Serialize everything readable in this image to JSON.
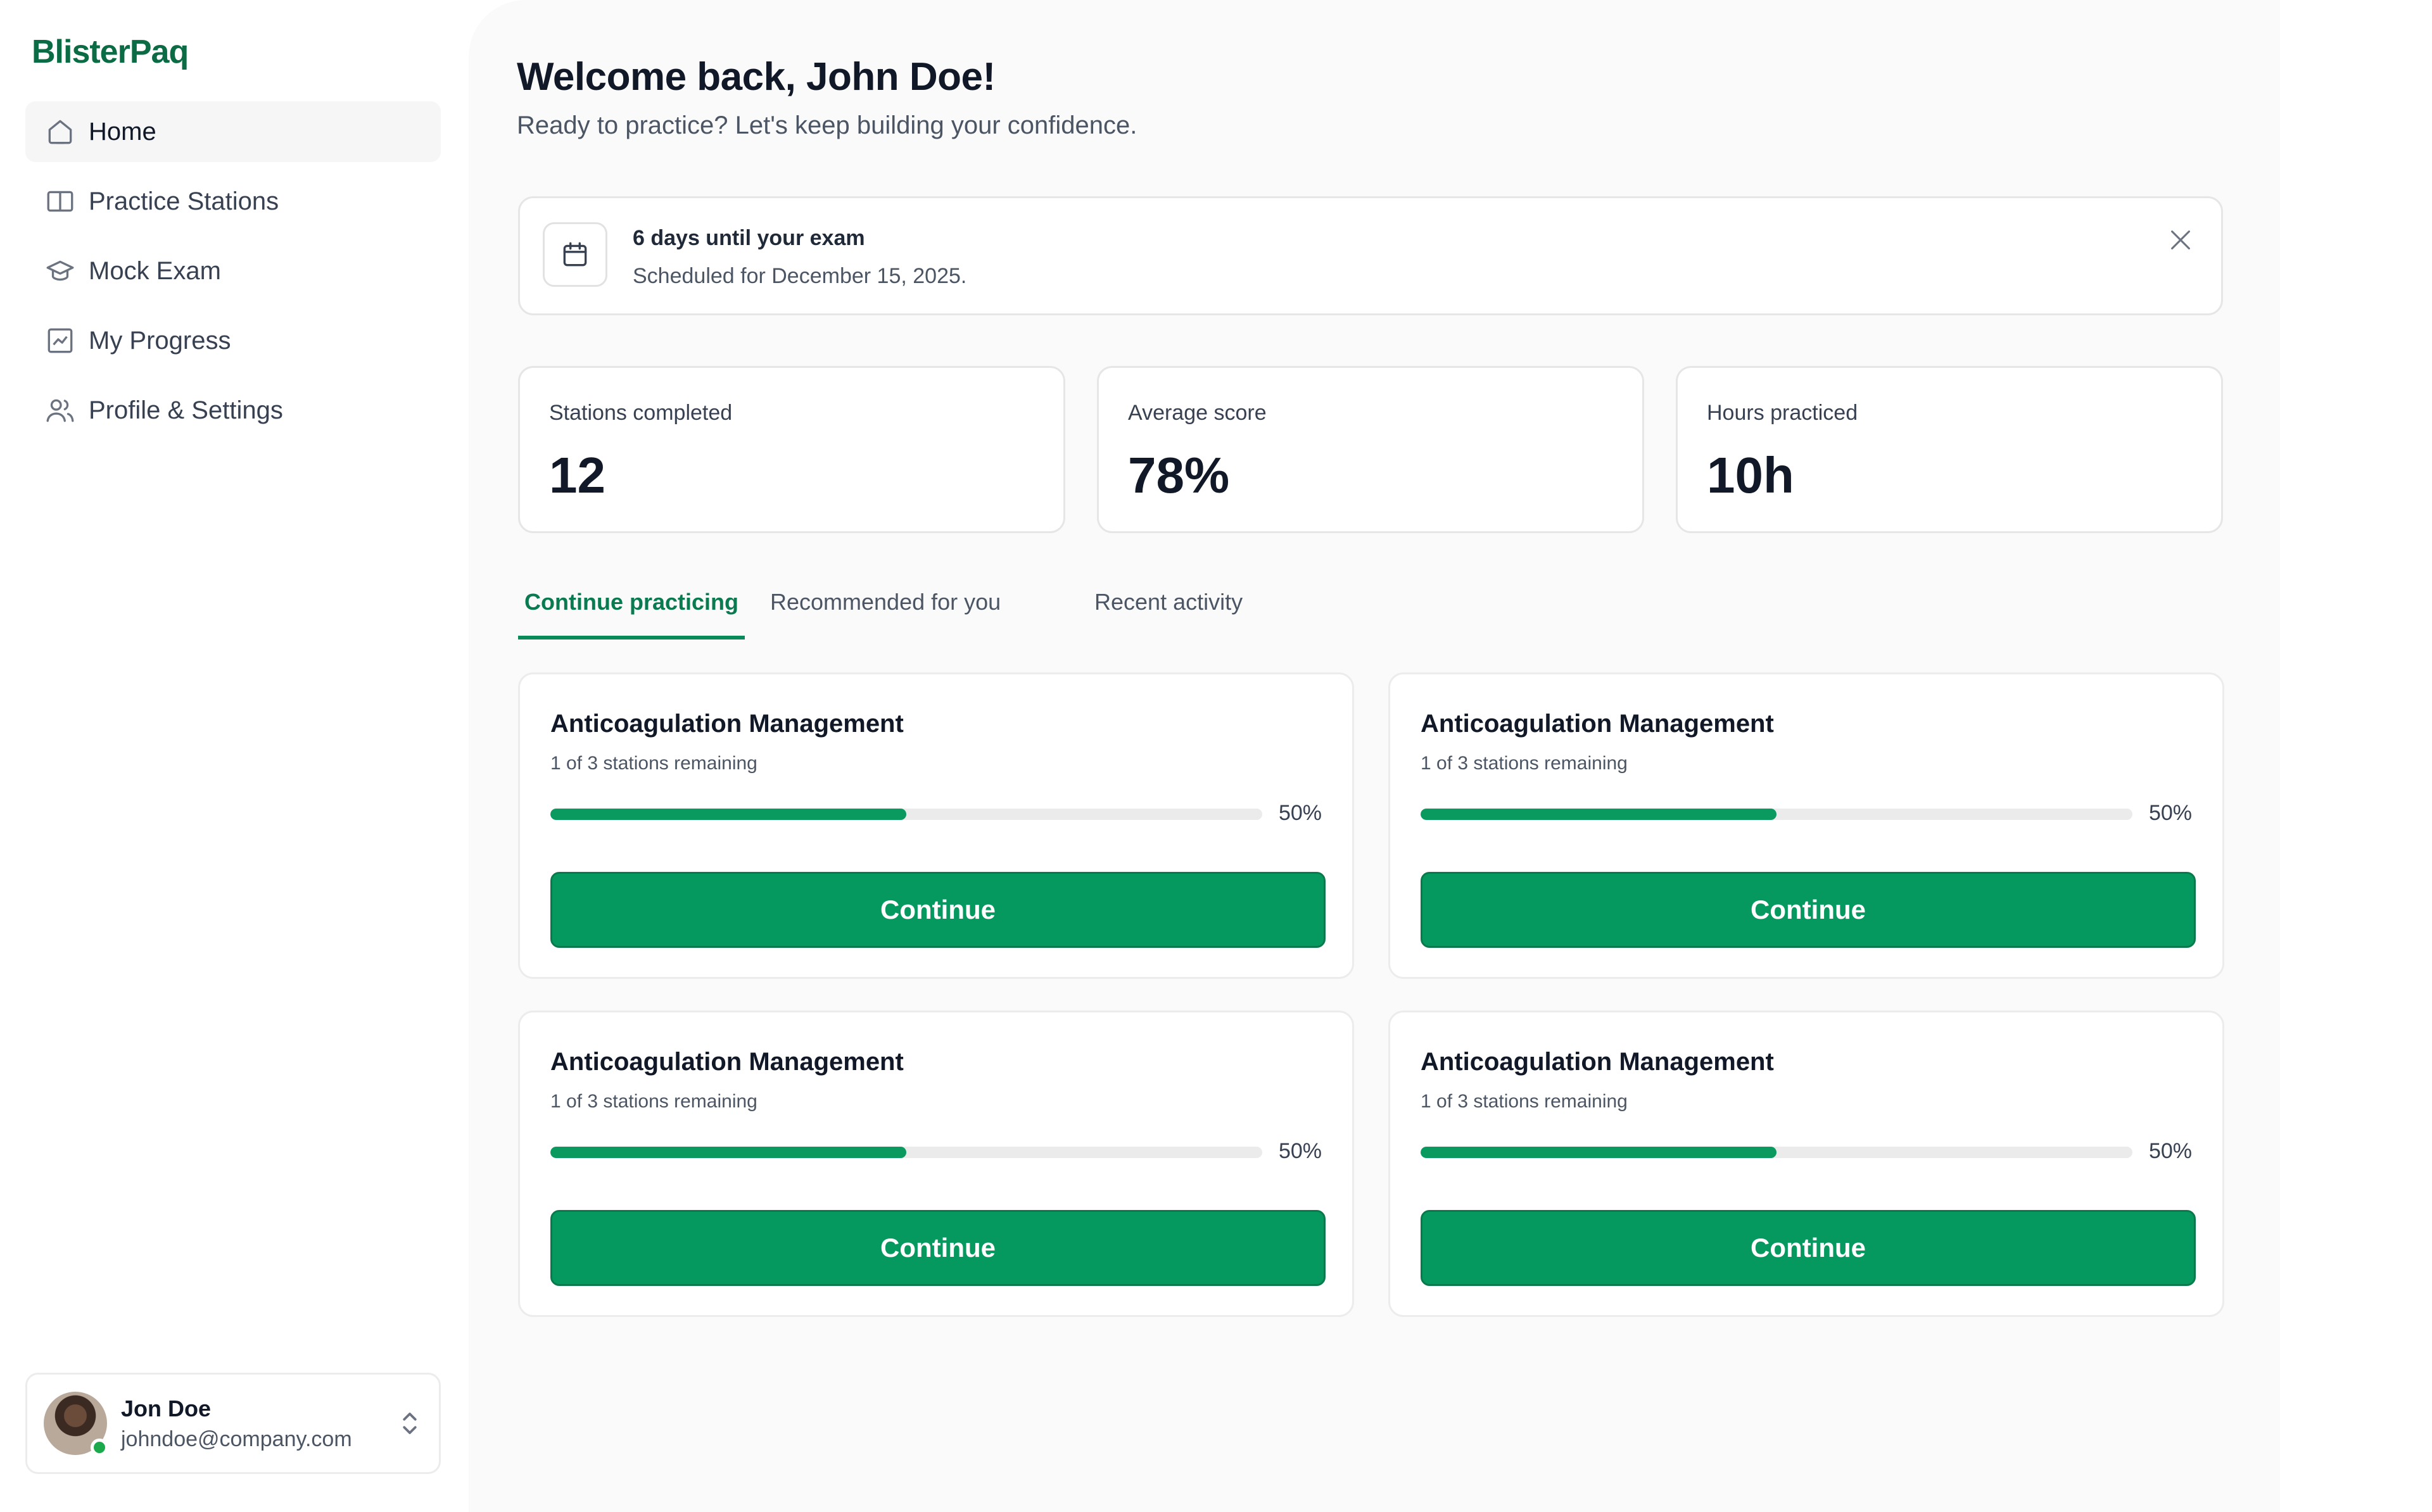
{
  "app": {
    "name": "BlisterPaq"
  },
  "sidebar": {
    "items": [
      {
        "label": "Home",
        "icon": "home-icon",
        "active": true
      },
      {
        "label": "Practice Stations",
        "icon": "book-open-icon",
        "active": false
      },
      {
        "label": "Mock Exam",
        "icon": "graduation-cap-icon",
        "active": false
      },
      {
        "label": "My Progress",
        "icon": "chart-line-icon",
        "active": false
      },
      {
        "label": "Profile & Settings",
        "icon": "users-icon",
        "active": false
      }
    ]
  },
  "user": {
    "name": "Jon Doe",
    "email": "johndoe@company.com",
    "status": "online"
  },
  "header": {
    "title": "Welcome back, John Doe!",
    "subtitle": "Ready to practice? Let's keep building your confidence."
  },
  "exam": {
    "title": "6 days until your exam",
    "subtitle": "Scheduled for December 15, 2025."
  },
  "stats": [
    {
      "label": "Stations completed",
      "value": "12"
    },
    {
      "label": "Average score",
      "value": "78%"
    },
    {
      "label": "Hours practiced",
      "value": "10h"
    }
  ],
  "tabs": [
    {
      "label": "Continue practicing",
      "active": true
    },
    {
      "label": "Recommended for you",
      "active": false
    },
    {
      "label": "Recent activity",
      "active": false
    }
  ],
  "cards": [
    {
      "title": "Anticoagulation Management",
      "subtitle": "1 of 3 stations remaining",
      "progress": 0.5,
      "progress_label": "50%",
      "button": "Continue"
    },
    {
      "title": "Anticoagulation Management",
      "subtitle": "1 of 3 stations remaining",
      "progress": 0.5,
      "progress_label": "50%",
      "button": "Continue"
    },
    {
      "title": "Anticoagulation Management",
      "subtitle": "1 of 3 stations remaining",
      "progress": 0.5,
      "progress_label": "50%",
      "button": "Continue"
    },
    {
      "title": "Anticoagulation Management",
      "subtitle": "1 of 3 stations remaining",
      "progress": 0.5,
      "progress_label": "50%",
      "button": "Continue"
    }
  ],
  "colors": {
    "brand": "#0a6b45",
    "accent": "#06995f",
    "status_online": "#1ba94c"
  }
}
